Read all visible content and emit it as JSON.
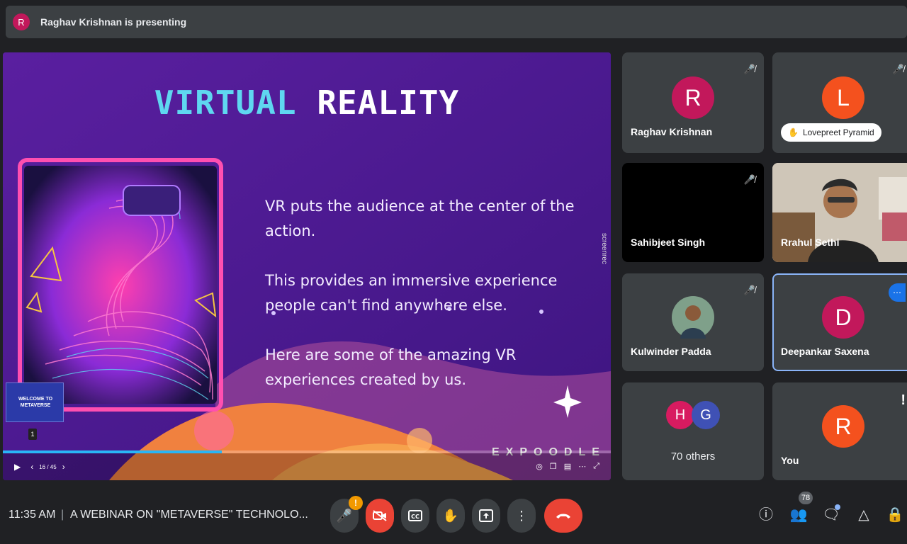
{
  "presenting_bar": {
    "avatar_initial": "R",
    "text": "Raghav Krishnan is presenting"
  },
  "slide": {
    "title_part1": "VIRTUAL",
    "title_part2": "REALITY",
    "paragraphs": [
      "VR puts the audience at the center of the action.",
      "This provides an immersive experience people can't find anywhere else.",
      "Here are some of the amazing VR experiences created by us."
    ],
    "watermark": "screenrec",
    "brand": "EXPOODLE",
    "thumbnail_text": "WELCOME TO METAVERSE",
    "thumbnail_page": "1",
    "slide_counter": "16 / 45",
    "progress_fraction": 0.36
  },
  "participants": [
    {
      "name": "Raghav Krishnan",
      "initial": "R",
      "color": "#c2185b",
      "muted": true
    },
    {
      "name": "Lovepreet Pyramid",
      "initial": "L",
      "color": "#f4511e",
      "muted": true,
      "hand_raised": true
    },
    {
      "name": "Sahibjeet Singh",
      "initial": "",
      "color": "#000000",
      "muted": true
    },
    {
      "name": "Rrahul Sethi",
      "initial": "",
      "color": "",
      "video": true
    },
    {
      "name": "Kulwinder Padda",
      "initial": "",
      "color": "#3c4043",
      "muted": true,
      "photo": true
    },
    {
      "name": "Deepankar Saxena",
      "initial": "D",
      "color": "#c2185b",
      "active_speaker": true
    },
    {
      "name": "70 others",
      "initials": [
        "H",
        "G"
      ],
      "colors": [
        "#d81b60",
        "#3f51b5"
      ]
    },
    {
      "name": "You",
      "initial": "R",
      "color": "#f4511e",
      "alert": "!"
    }
  ],
  "bottom_bar": {
    "time": "11:35 AM",
    "separator": "|",
    "meeting_title": "A WEBINAR ON \"METAVERSE\" TECHNOLO...",
    "mic_warning": "!",
    "people_count": "78"
  },
  "colors": {
    "accent": "#1a73e8",
    "danger": "#ea4335",
    "warning": "#f29900",
    "tile_bg": "#3c4043",
    "page_bg": "#202124"
  }
}
